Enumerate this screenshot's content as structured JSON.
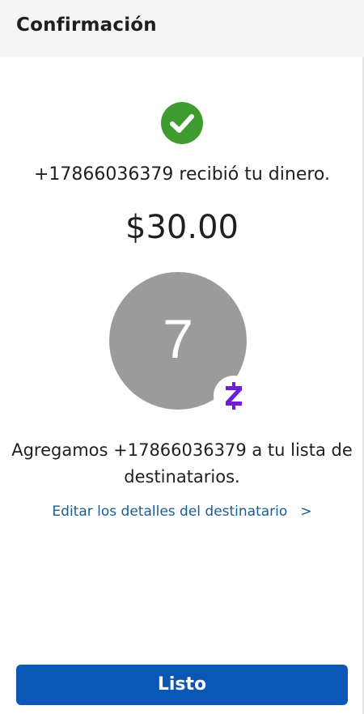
{
  "header": {
    "title": "Confirmación"
  },
  "confirmation": {
    "received_message": "+17866036379 recibió tu dinero.",
    "amount": "$30.00",
    "success_icon": "check-circle-icon",
    "success_color": "#3f9b2f"
  },
  "recipient": {
    "avatar_initial": "7",
    "avatar_color": "#9b9b9b",
    "badge_icon": "zelle-logo-icon",
    "badge_color": "#6d1ed4"
  },
  "added_message": {
    "line1": "Agregamos +17866036379 a tu lista de",
    "line2": "destinatarios."
  },
  "edit_link": {
    "label": "Editar los detalles del destinatario",
    "chevron": ">"
  },
  "done_button": {
    "label": "Listo",
    "color": "#0b57b6"
  }
}
